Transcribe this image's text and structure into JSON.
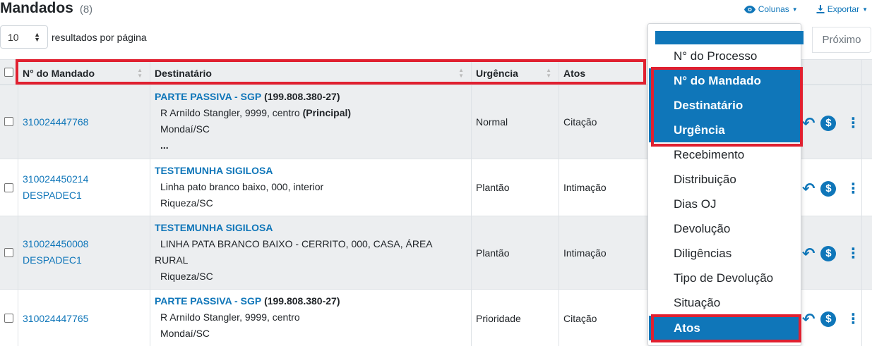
{
  "header": {
    "title": "Mandados",
    "count": "(8)",
    "columns_button": "Colunas",
    "export_button": "Exportar"
  },
  "per_page": {
    "value": "10",
    "label": "resultados por página"
  },
  "pagination": {
    "next_label": "Próximo"
  },
  "table": {
    "columns": [
      "N° do Mandado",
      "Destinatário",
      "Urgência",
      "Atos"
    ],
    "rows": [
      {
        "mandado": [
          "310024447768"
        ],
        "dest_name": "PARTE PASSIVA - SGP",
        "dest_doc": "(199.808.380-27)",
        "address": "R Arnildo Stangler, 9999, centro",
        "address_tag": "(Principal)",
        "city": "Mondaí/SC",
        "more": "...",
        "urgencia": "Normal",
        "atos": "Citação"
      },
      {
        "mandado": [
          "310024450214",
          "DESPADEC1"
        ],
        "dest_name": "TESTEMUNHA SIGILOSA",
        "dest_doc": "",
        "address": "Linha pato branco baixo, 000, interior",
        "city": "Riqueza/SC",
        "urgencia": "Plantão",
        "atos": "Intimação"
      },
      {
        "mandado": [
          "310024450008",
          "DESPADEC1"
        ],
        "dest_name": "TESTEMUNHA SIGILOSA",
        "dest_doc": "",
        "address_line1": "LINHA PATA BRANCO BAIXO - CERRITO, 000, CASA, ÁREA",
        "address_line2": "RURAL",
        "city": "Riqueza/SC",
        "urgencia": "Plantão",
        "atos": "Intimação"
      },
      {
        "mandado": [
          "310024447765"
        ],
        "dest_name": "PARTE PASSIVA - SGP",
        "dest_doc": "(199.808.380-27)",
        "address": "R Arnildo Stangler, 9999, centro",
        "city": "Mondaí/SC",
        "urgencia": "Prioridade",
        "atos": "Citação"
      }
    ]
  },
  "columns_menu": {
    "items": [
      {
        "label": "N° do Processo",
        "active": false
      },
      {
        "label": "N° do Mandado",
        "active": true
      },
      {
        "label": "Destinatário",
        "active": true
      },
      {
        "label": "Urgência",
        "active": true
      },
      {
        "label": "Recebimento",
        "active": false
      },
      {
        "label": "Distribuição",
        "active": false
      },
      {
        "label": "Dias OJ",
        "active": false
      },
      {
        "label": "Devolução",
        "active": false
      },
      {
        "label": "Diligências",
        "active": false
      },
      {
        "label": "Tipo de Devolução",
        "active": false
      },
      {
        "label": "Situação",
        "active": false
      },
      {
        "label": "Atos",
        "active": true
      }
    ]
  },
  "icons": {
    "eye": "eye-icon",
    "download": "download-icon",
    "undo": "undo-icon",
    "dollar": "dollar-circle-icon",
    "kebab": "kebab-menu-icon"
  },
  "colors": {
    "accent": "#0f76b9",
    "highlight_border": "#e02030",
    "row_alt": "#eceef0"
  }
}
